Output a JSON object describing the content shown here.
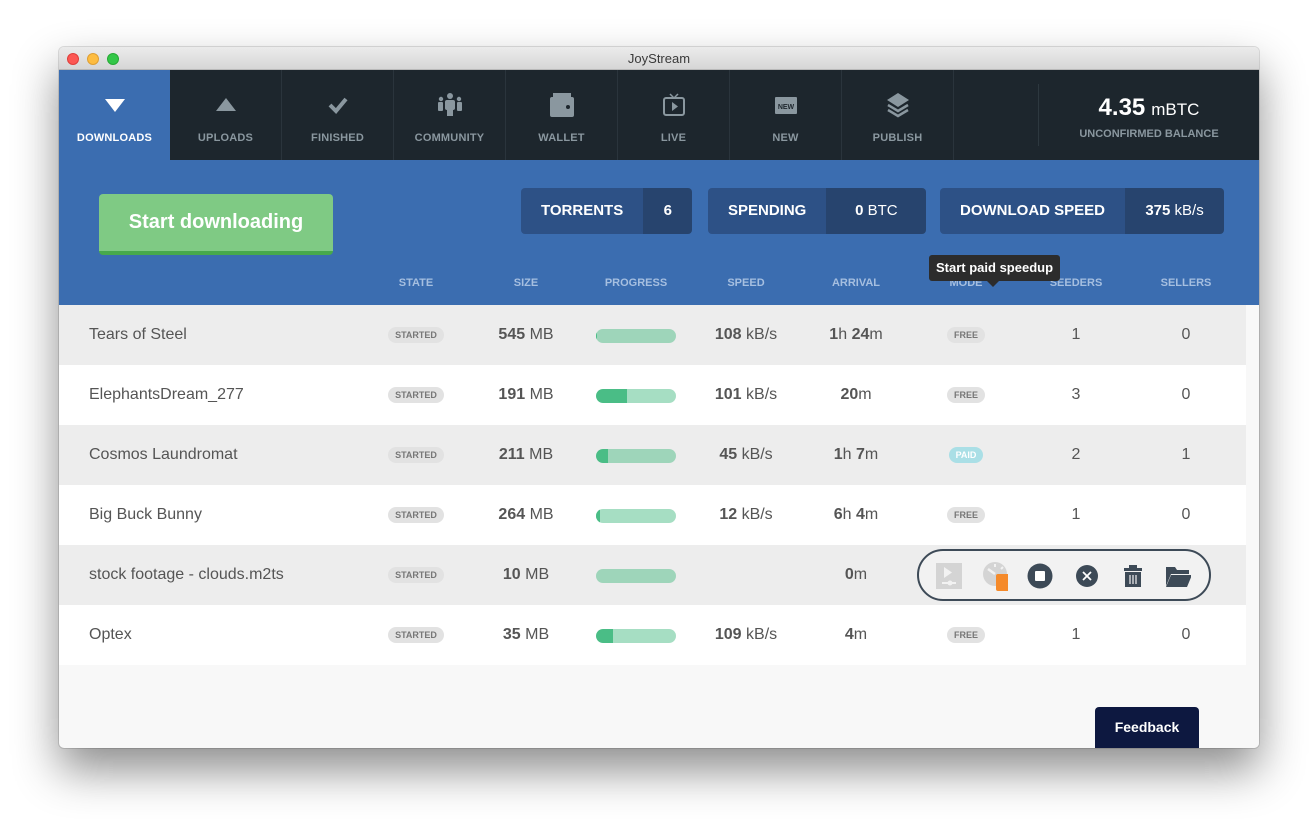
{
  "window": {
    "title": "JoyStream"
  },
  "nav": {
    "items": [
      {
        "label": "DOWNLOADS",
        "icon": "triangle-down-icon",
        "active": true
      },
      {
        "label": "UPLOADS",
        "icon": "triangle-up-icon"
      },
      {
        "label": "FINISHED",
        "icon": "checkmark-icon"
      },
      {
        "label": "COMMUNITY",
        "icon": "community-icon"
      },
      {
        "label": "WALLET",
        "icon": "wallet-icon"
      },
      {
        "label": "LIVE",
        "icon": "tv-icon"
      },
      {
        "label": "NEW",
        "icon": "new-badge-icon"
      },
      {
        "label": "PUBLISH",
        "icon": "layers-icon"
      }
    ],
    "balance": {
      "amount": "4.35",
      "unit": "mBTC",
      "label": "UNCONFIRMED BALANCE"
    }
  },
  "header": {
    "start_button": "Start downloading",
    "stats": {
      "torrents": {
        "label": "TORRENTS",
        "value": "6"
      },
      "spending": {
        "label": "SPENDING",
        "value": "0",
        "unit": "BTC"
      },
      "speed": {
        "label": "DOWNLOAD SPEED",
        "value": "375",
        "unit": "kB/s"
      }
    },
    "columns": [
      "STATE",
      "SIZE",
      "PROGRESS",
      "SPEED",
      "ARRIVAL",
      "MODE",
      "SEEDERS",
      "SELLERS"
    ]
  },
  "torrents": [
    {
      "name": "Tears of Steel",
      "state": "STARTED",
      "size": "545",
      "size_unit": "MB",
      "progress": 0.01,
      "speed": "108",
      "speed_unit": "kB/s",
      "arrival_h": "1",
      "arrival_m": "24",
      "mode": "FREE",
      "seeders": "1",
      "sellers": "0"
    },
    {
      "name": "ElephantsDream_277",
      "state": "STARTED",
      "size": "191",
      "size_unit": "MB",
      "progress": 0.39,
      "speed": "101",
      "speed_unit": "kB/s",
      "arrival_h": "",
      "arrival_m": "20",
      "mode": "FREE",
      "seeders": "3",
      "sellers": "0"
    },
    {
      "name": "Cosmos Laundromat",
      "state": "STARTED",
      "size": "211",
      "size_unit": "MB",
      "progress": 0.15,
      "speed": "45",
      "speed_unit": "kB/s",
      "arrival_h": "1",
      "arrival_m": "7",
      "mode": "PAID",
      "seeders": "2",
      "sellers": "1"
    },
    {
      "name": "Big Buck Bunny",
      "state": "STARTED",
      "size": "264",
      "size_unit": "MB",
      "progress": 0.05,
      "speed": "12",
      "speed_unit": "kB/s",
      "arrival_h": "6",
      "arrival_m": "4",
      "mode": "FREE",
      "seeders": "1",
      "sellers": "0"
    },
    {
      "name": "stock footage - clouds.m2ts",
      "state": "STARTED",
      "size": "10",
      "size_unit": "MB",
      "progress": 0.0,
      "speed": "",
      "speed_unit": "",
      "arrival_h": "",
      "arrival_m": "0",
      "mode": "",
      "seeders": "",
      "sellers": "",
      "hovered": true
    },
    {
      "name": "Optex",
      "state": "STARTED",
      "size": "35",
      "size_unit": "MB",
      "progress": 0.21,
      "speed": "109",
      "speed_unit": "kB/s",
      "arrival_h": "",
      "arrival_m": "4",
      "mode": "FREE",
      "seeders": "1",
      "sellers": "0"
    }
  ],
  "units": {
    "hour": "h",
    "minute": "m"
  },
  "actions": {
    "tooltip": "Start paid speedup",
    "buttons": [
      "play-media",
      "paid-speedup",
      "stop",
      "remove",
      "delete",
      "open-folder"
    ],
    "info_badge": "i"
  },
  "feedback": "Feedback",
  "colors": {
    "accent_blue": "#3b6db0",
    "nav_bg": "#1d262d",
    "start_green": "#7fca84",
    "progress_fill": "#4abd86",
    "progress_track": "#a6dec3",
    "paid_badge": "#aadfe6",
    "info_orange": "#f58a2a",
    "feedback_navy": "#0d1840"
  }
}
